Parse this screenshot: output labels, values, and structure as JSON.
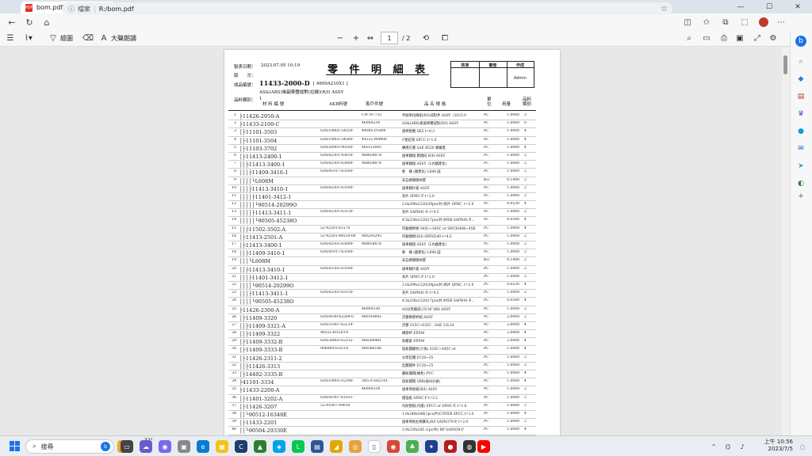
{
  "browser": {
    "tab_title": "bom.pdf",
    "tab_close": "✕",
    "new_tab": "+",
    "url_prefix": "檔案",
    "url": "R:/bom.pdf",
    "minimize": "—",
    "maximize": "☐",
    "close": "✕"
  },
  "pdf_toolbar": {
    "draw_label": "繪圖",
    "read_aloud_label": "大聲朗讀",
    "page_current": "1",
    "page_total": "/ 2"
  },
  "doc": {
    "print_date_label": "製表日期：",
    "print_date": "2023.07.05 10:19",
    "version_label": "版　　次：",
    "product_label": "成品編號：",
    "product_no": "11433-2000-D",
    "product_code": "[ 4600A210X1 ]",
    "product_desc": "AS&(ABS)後副車體成對(拉線)(R/I) ASSY",
    "category_label": "品料類別：",
    "category": "1",
    "title": "零 件 明 細 表",
    "sign": {
      "approve": "核准",
      "review": "審查",
      "make": "作成",
      "maker": "Admin"
    },
    "headers": {
      "part": "材 料 編 號",
      "akb": "AKB料號",
      "cust": "客戶件號",
      "name": "品 名 規 格",
      "unit": "單位",
      "qty": "用量",
      "cls": "品料類別"
    },
    "rows": [
      {
        "idx": "1",
        "part": "├11426-2950-A",
        "akb": "",
        "cust": "CW787753",
        "name": "手副車拉線組(R/I)成對件 ASSY（2023.9",
        "unit": "PC",
        "qty": "1.0000",
        "cls": "3"
      },
      {
        "idx": "2",
        "part": "├11433-2100-C",
        "akb": "",
        "cust": "4600A210",
        "name": "AS&(ABS)後副車體成對(R/I) ASSY",
        "unit": "PC",
        "qty": "1.0000",
        "cls": "0"
      },
      {
        "idx": "3",
        "part": "│├11101-3503",
        "akb": "GOS10801-54550-",
        "cust": "44085-01A00",
        "name": "連桿墊圈 SK5 t=0.3",
        "unit": "PC",
        "qty": "1.0000",
        "cls": "4"
      },
      {
        "idx": "4",
        "part": "│├11101-3504",
        "akb": "GOS10801-54560-",
        "cust": "44222-M4900",
        "name": "C墊紅環 SPCC t=1.6",
        "unit": "PC",
        "qty": "1.0000",
        "cls": "4"
      },
      {
        "idx": "5",
        "part": "│├11103-3702",
        "akb": "GOS50001-00100-",
        "cust": "MA151645",
        "name": "轉用孔塞 SAE R520 彈簧蓋",
        "unit": "PC",
        "qty": "1.0000",
        "cls": "4"
      },
      {
        "idx": "6",
        "part": "│├11413-2400-1",
        "akb": "GOS42501-43010-",
        "cust": "MB858878",
        "name": "副車翻組.懸鏈成 R/H ASSY",
        "unit": "PC",
        "qty": "1.0000",
        "cls": "2"
      },
      {
        "idx": "7",
        "part": "││├11413-3400-1",
        "akb": "GOS42501-63000-",
        "cust": "MB858876",
        "name": "副車翻組 ASSY（L內國產化）",
        "unit": "PC",
        "qty": "1.0000",
        "cls": "2"
      },
      {
        "idx": "8",
        "part": "│││├11409-3416-1",
        "akb": "GOS41017-63160-",
        "cust": "",
        "name": "軟　桶 (國產化) L608 田",
        "unit": "PC",
        "qty": "1.0000",
        "cls": "2"
      },
      {
        "idx": "9",
        "part": "││││└L608M",
        "akb": "",
        "cust": "",
        "name": "非石綿摩擦材質",
        "unit": "KG",
        "qty": "0.1400",
        "cls": "2"
      },
      {
        "idx": "10",
        "part": "│││├11413-3410-1",
        "akb": "GOS42501-63100-",
        "cust": "",
        "name": "副車翻片組 ASSY",
        "unit": "PC",
        "qty": "1.0000",
        "cls": "2"
      },
      {
        "idx": "11",
        "part": "││││├11401-3412-1",
        "akb": "",
        "cust": "",
        "name": "背片 SPHC-P t=2.0",
        "unit": "PC",
        "qty": "1.0000",
        "cls": "2"
      },
      {
        "idx": "12",
        "part": "│││││└90514-20299O",
        "akb": "",
        "cust": "",
        "name": "2.0x299x1220(39pcs/片)背片 SPHC, t=2.0",
        "unit": "PC",
        "qty": "0.0530",
        "cls": "4"
      },
      {
        "idx": "13",
        "part": "││││├11413-3411-1",
        "akb": "GOS42501-63110-",
        "cust": "",
        "name": "背片 SAPH41-P, t=4.5",
        "unit": "PC",
        "qty": "1.0000",
        "cls": "2"
      },
      {
        "idx": "14",
        "part": "│││││└90505-45238O",
        "akb": "",
        "cust": "",
        "name": "4.5x238x1220(17pcs/片)WEB SAPH41-P…",
        "unit": "PC",
        "qty": "0.0590",
        "cls": "4"
      },
      {
        "idx": "15",
        "part": "││├11502-3502-A",
        "akb": "52-42501-65170",
        "cust": "",
        "name": "作動撐桿柄 S45C~S45C or SWCH40K~45K",
        "unit": "PC",
        "qty": "1.0000",
        "cls": "4"
      },
      {
        "idx": "16",
        "part": "│├11413-2501-A",
        "akb": "52-42501-44510-00",
        "cust": "MR205295",
        "name": "作動撐桿(R/I) SPFH540 t=4.5",
        "unit": "PC",
        "qty": "1.0000",
        "cls": "2"
      },
      {
        "idx": "17",
        "part": "│├11413-3400-1",
        "akb": "GOS42501-63000-",
        "cust": "MB858876",
        "name": "副車翻組 ASSY（L內國產化）",
        "unit": "PC",
        "qty": "1.0000",
        "cls": "2"
      },
      {
        "idx": "18",
        "part": "││├11409-3416-1",
        "akb": "GOS41017-63160-",
        "cust": "",
        "name": "軟　桶 (國產化) L608 田",
        "unit": "PC",
        "qty": "1.0000",
        "cls": "2"
      },
      {
        "idx": "19",
        "part": "│││└L608M",
        "akb": "",
        "cust": "",
        "name": "非石綿摩擦材質",
        "unit": "KG",
        "qty": "0.1400",
        "cls": "2"
      },
      {
        "idx": "20",
        "part": "││├11413-3410-1",
        "akb": "GOS42501-63100-",
        "cust": "",
        "name": "副車翻片組 ASSY",
        "unit": "PC",
        "qty": "1.0000",
        "cls": "2"
      },
      {
        "idx": "21",
        "part": "│││├11401-3412-1",
        "akb": "",
        "cust": "",
        "name": "背片 SPHC-P t=2.0",
        "unit": "PC",
        "qty": "1.0000",
        "cls": "2"
      },
      {
        "idx": "22",
        "part": "││││└90514-20299O",
        "akb": "",
        "cust": "",
        "name": "2.0x299x1220(39pcs/片)背片 SPHC, t=2.0",
        "unit": "PC",
        "qty": "0.0530",
        "cls": "4"
      },
      {
        "idx": "23",
        "part": "│││├11413-3411-1",
        "akb": "GOS42501-63110-",
        "cust": "",
        "name": "背片 SAPH41-P, t=4.5",
        "unit": "PC",
        "qty": "1.0000",
        "cls": "2"
      },
      {
        "idx": "24",
        "part": "││││└90505-45238O",
        "akb": "",
        "cust": "",
        "name": "4.5x238x1220(17pcs/片)WEB SAPH41-P…",
        "unit": "PC",
        "qty": "0.0590",
        "cls": "4"
      },
      {
        "idx": "25",
        "part": "├11426-2300-A",
        "akb": "",
        "cust": "4600A130",
        "name": "AS分泵總成(15/16\")RH ASSY",
        "unit": "PC",
        "qty": "1.0000",
        "cls": "2"
      },
      {
        "idx": "26",
        "part": "│├11409-3320",
        "akb": "GOS4100-62204-0",
        "cust": "MB193692",
        "name": "活塞橡膠杯組 ASSY",
        "unit": "PC",
        "qty": "2.0000",
        "cls": "2"
      },
      {
        "idx": "27",
        "part": "││├11409-3321-A",
        "akb": "GOS51407-62214-",
        "cust": "",
        "name": "活塞 S15C~S25C , SAE 12L14",
        "unit": "PC",
        "qty": "2.0000",
        "cls": "4"
      },
      {
        "idx": "28",
        "part": "││├11409-3322",
        "akb": "9055130150-01",
        "cust": "",
        "name": "橡膠杯 EPDM",
        "unit": "PC",
        "qty": "2.0000",
        "cls": "4"
      },
      {
        "idx": "29",
        "part": "│├11409-3332-B",
        "akb": "GOS30801-62312-",
        "cust": "MB500481",
        "name": "防塵套 EPDM",
        "unit": "PC",
        "qty": "2.0000",
        "cls": "4"
      },
      {
        "idx": "30",
        "part": "│├11409-3333-B",
        "akb": "9060001032-01",
        "cust": "MB366146",
        "name": "放氣閥螺栓(六角) S35C~S45C or",
        "unit": "PC",
        "qty": "1.0000",
        "cls": "4"
      },
      {
        "idx": "31",
        "part": "│├11426-2311-2",
        "akb": "",
        "cust": "",
        "name": "分泵缸體 FC20~25",
        "unit": "PC",
        "qty": "1.0000",
        "cls": "2"
      },
      {
        "idx": "32",
        "part": "││├11426-3313",
        "akb": "",
        "cust": "",
        "name": "缸體鑄件 FC20~25",
        "unit": "PC",
        "qty": "1.0000",
        "cls": "5"
      },
      {
        "idx": "33",
        "part": "│├14402-3335-B",
        "akb": "",
        "cust": "",
        "name": "螺紋護帽(橘色) PVC",
        "unit": "PC",
        "qty": "1.0000",
        "cls": "4"
      },
      {
        "idx": "34",
        "part": "├41101-3334",
        "akb": "GOS10001-02340-",
        "cust": "3XG-F5825-01",
        "name": "放氣閥帽 SBR(福州分倉)",
        "unit": "PC",
        "qty": "1.0000",
        "cls": "4"
      },
      {
        "idx": "35",
        "part": "├11433-2200-A",
        "akb": "",
        "cust": "4600A318",
        "name": "副車骨板組(R/I) ASSY",
        "unit": "PC",
        "qty": "1.0000",
        "cls": "2"
      },
      {
        "idx": "36",
        "part": "│├11401-3202-A",
        "akb": "GOS41007-61031-",
        "cust": "",
        "name": "擋強板 SPHC-P t=3.2",
        "unit": "PC",
        "qty": "1.0000",
        "cls": "2"
      },
      {
        "idx": "37",
        "part": "│├11426-3207",
        "akb": "52-41007-69030",
        "cust": "",
        "name": "內防墊板(內擋) SPCC or SPHC-P, t=1.6",
        "unit": "PC",
        "qty": "1.0000",
        "cls": "2"
      },
      {
        "idx": "38",
        "part": "││└90512-16348E",
        "akb": "",
        "cust": "",
        "name": "1.6x348x348(1pcs/片)COVER SPCC,t=1.6",
        "unit": "PC",
        "qty": "1.0000",
        "cls": "4"
      },
      {
        "idx": "39",
        "part": "│├11433-2201",
        "akb": "",
        "cust": "",
        "name": "副車骨板右側簧孔(R/I SAPH370-P, t=2.9",
        "unit": "PC",
        "qty": "1.0000",
        "cls": "2"
      },
      {
        "idx": "40",
        "part": "││└90504-29330E",
        "akb": "",
        "cust": "",
        "name": "2.9x330x345 (1pc/片) BP SAPH39-P",
        "unit": "PC",
        "qty": "1.0000",
        "cls": "4"
      }
    ]
  },
  "taskbar": {
    "search_label": "搜尋",
    "weather": "32°",
    "time": "上午 10:56",
    "date": "2023/7/5"
  }
}
